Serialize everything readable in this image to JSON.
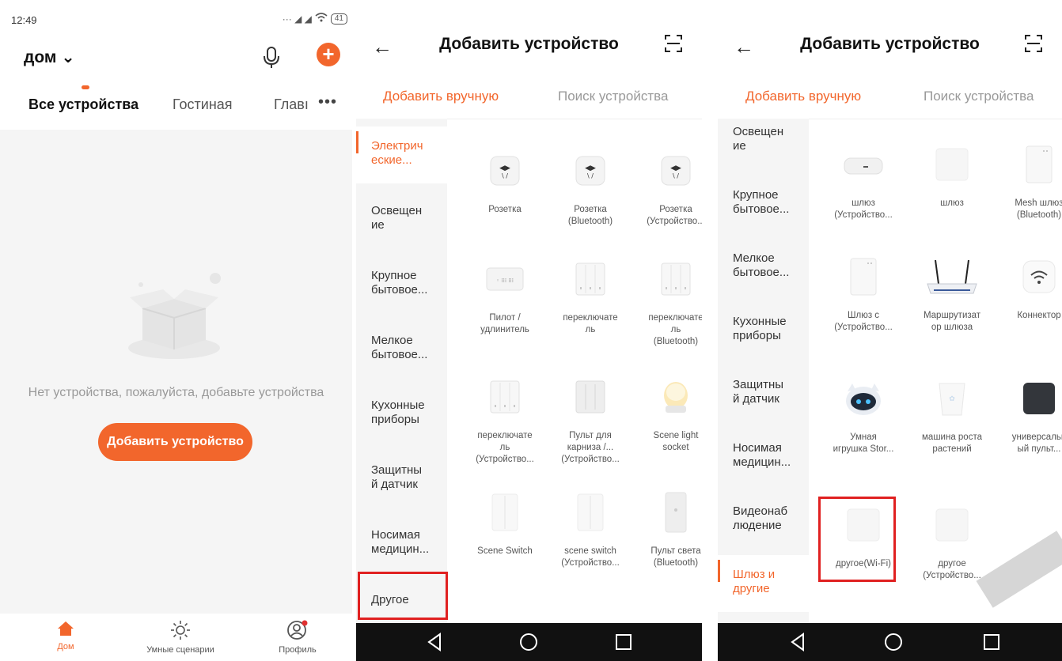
{
  "phone1": {
    "status": {
      "time": "12:49",
      "battery": "41"
    },
    "header": {
      "home_label": "дом ⌄"
    },
    "tabs": [
      "Все устройства",
      "Гостиная",
      "Главı"
    ],
    "empty_text": "Нет устройства, пожалуйста, добавьте устройства",
    "add_button": "Добавить устройство",
    "bottom_nav": [
      "Дом",
      "Умные сценарии",
      "Профиль"
    ],
    "accent": "#f2662c"
  },
  "phone2": {
    "title": "Добавить устройство",
    "subtabs": [
      "Добавить вручную",
      "Поиск устройства"
    ],
    "categories": [
      "Электрич ческие...",
      "Освещен ие",
      "Крупное бытовое...",
      "Мелкое бытовое...",
      "Кухонные приборы",
      "Защитны й датчик",
      "Носимая медицин...",
      "Другое"
    ],
    "categories_lines": [
      [
        "Электрич",
        "еские..."
      ],
      [
        "Освещен",
        "ие"
      ],
      [
        "Крупное",
        "бытовое..."
      ],
      [
        "Мелкое",
        "бытовое..."
      ],
      [
        "Кухонные",
        "приборы"
      ],
      [
        "Защитны",
        "й датчик"
      ],
      [
        "Носимая",
        "медицин..."
      ],
      [
        "Другое"
      ]
    ],
    "devices": [
      [
        "Розетка"
      ],
      [
        "Розетка",
        "(Bluetooth)"
      ],
      [
        "Розетка",
        "(Устройство..."
      ],
      [
        "Пилот /",
        "удлинитель"
      ],
      [
        "переключате",
        "ль"
      ],
      [
        "переключате",
        "ль",
        "(Bluetooth)"
      ],
      [
        "переключате",
        "ль",
        "(Устройство..."
      ],
      [
        "Пульт для",
        "карниза /...",
        "(Устройство..."
      ],
      [
        "Scene light",
        "socket"
      ],
      [
        "Scene Switch"
      ],
      [
        "scene switch",
        "(Устройство..."
      ],
      [
        "Пульт света",
        "(Bluetooth)"
      ]
    ]
  },
  "phone3": {
    "title": "Добавить устройство",
    "subtabs": [
      "Добавить вручную",
      "Поиск устройства"
    ],
    "categories_lines": [
      [
        "Освещен",
        "ие"
      ],
      [
        "Крупное",
        "бытовое..."
      ],
      [
        "Мелкое",
        "бытовое..."
      ],
      [
        "Кухонные",
        "приборы"
      ],
      [
        "Защитны",
        "й датчик"
      ],
      [
        "Носимая",
        "медицин..."
      ],
      [
        "Видеонаб",
        "людение"
      ],
      [
        "Шлюз и",
        "другие"
      ]
    ],
    "devices": [
      [
        "шлюз",
        "(Устройство..."
      ],
      [
        "шлюз"
      ],
      [
        "Mesh шлюз",
        "(Bluetooth)"
      ],
      [
        "Шлюз с",
        "(Устройство..."
      ],
      [
        "Маршрутизат",
        "ор шлюза"
      ],
      [
        "Коннектор"
      ],
      [
        "Умная",
        "игрушка Stor..."
      ],
      [
        "машина роста",
        "растений"
      ],
      [
        "универсальн",
        "ый пульт..."
      ],
      [
        "другое(Wi-Fi)"
      ],
      [
        "другое",
        "(Устройство..."
      ]
    ]
  }
}
